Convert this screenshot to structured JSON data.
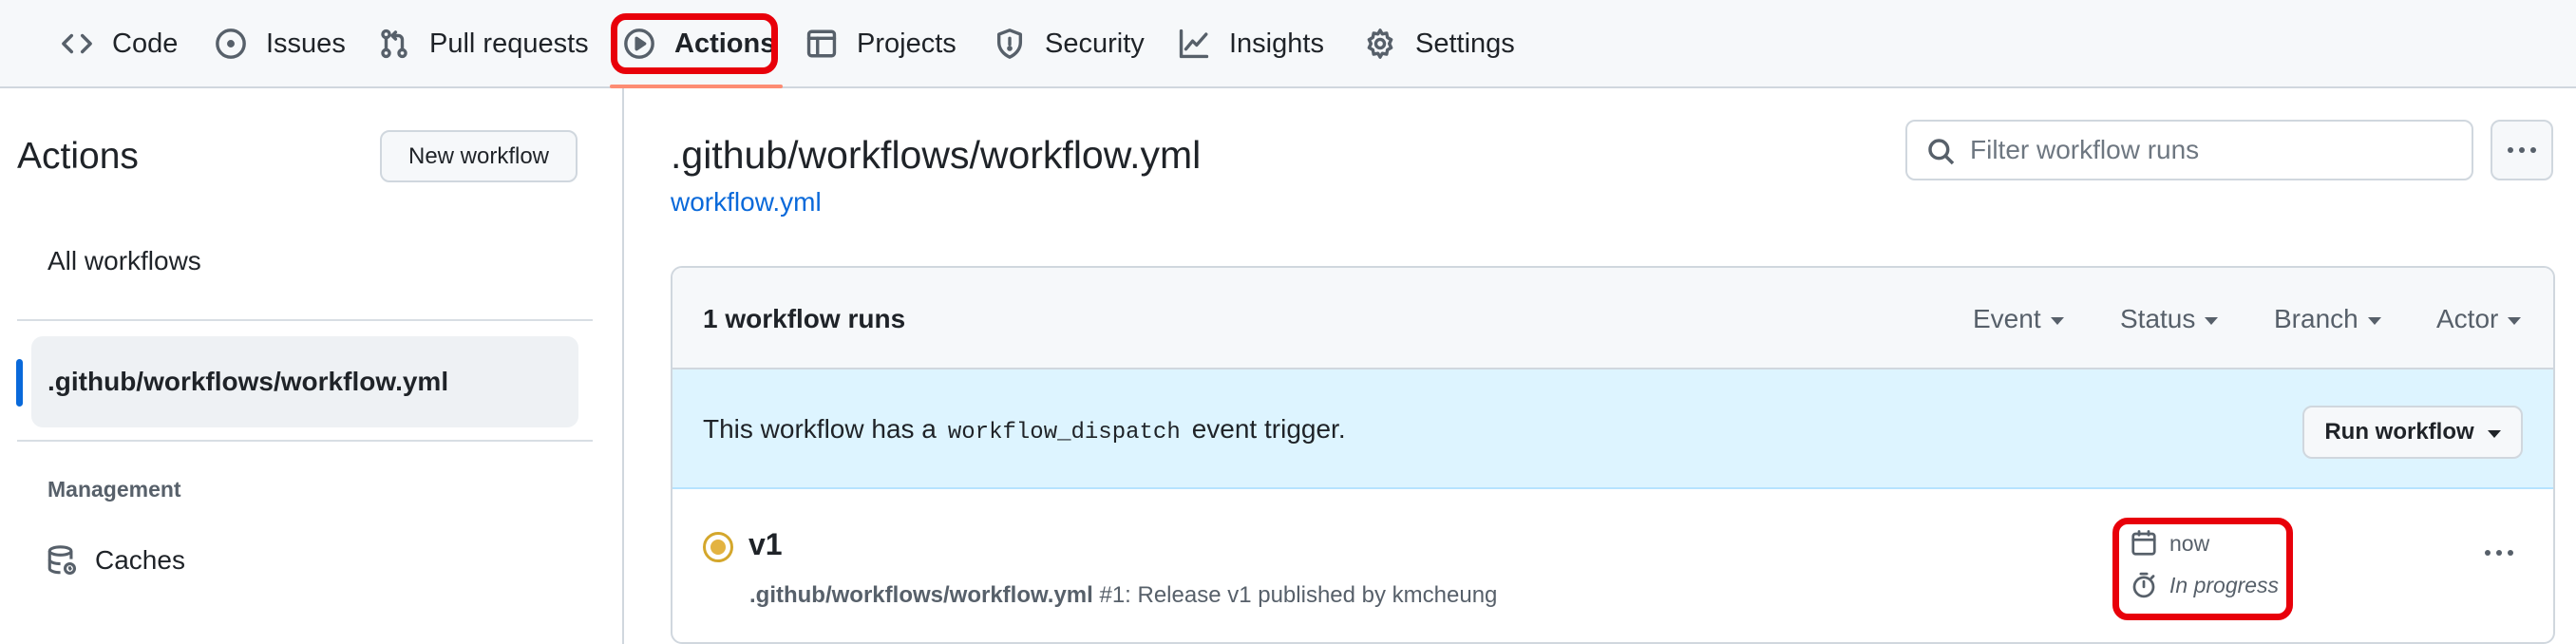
{
  "nav": {
    "tabs": [
      {
        "label": "Code",
        "icon": "code-icon"
      },
      {
        "label": "Issues",
        "icon": "issue-opened-icon"
      },
      {
        "label": "Pull requests",
        "icon": "git-pull-request-icon"
      },
      {
        "label": "Actions",
        "icon": "play-icon"
      },
      {
        "label": "Projects",
        "icon": "table-icon"
      },
      {
        "label": "Security",
        "icon": "shield-icon"
      },
      {
        "label": "Insights",
        "icon": "graph-icon"
      },
      {
        "label": "Settings",
        "icon": "gear-icon"
      }
    ],
    "active_tab": "Actions",
    "underline_color": "#fd8c73"
  },
  "sidebar": {
    "title": "Actions",
    "new_workflow_label": "New workflow",
    "all_workflows_label": "All workflows",
    "selected_workflow": ".github/workflows/workflow.yml",
    "management_heading": "Management",
    "caches_label": "Caches"
  },
  "main": {
    "workflow_title": ".github/workflows/workflow.yml",
    "workflow_file_link": "workflow.yml",
    "filter_placeholder": "Filter workflow runs",
    "runs_count": "1 workflow runs",
    "filters": [
      "Event",
      "Status",
      "Branch",
      "Actor"
    ],
    "dispatch": {
      "prefix": "This workflow has a",
      "code": "workflow_dispatch",
      "suffix": "event trigger."
    },
    "run_workflow_label": "Run workflow",
    "run": {
      "name": "v1",
      "workflow": ".github/workflows/workflow.yml",
      "detail": "#1: Release v1 published by kmcheung",
      "time": "now",
      "duration": "In progress",
      "status": "in_progress",
      "status_color": "#e3b341"
    }
  },
  "annotations": {
    "highlight_color": "#e8000a"
  }
}
